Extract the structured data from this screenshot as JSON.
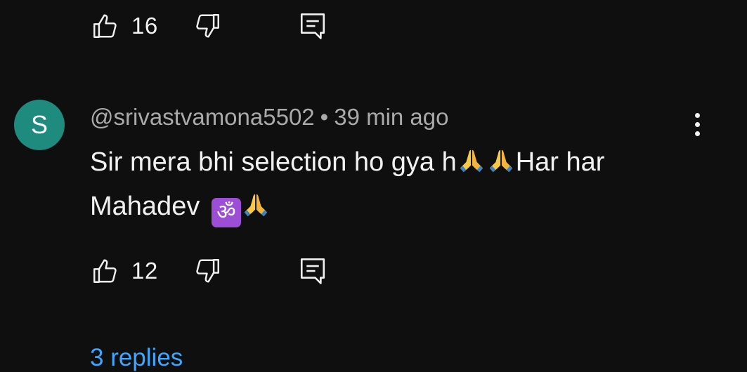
{
  "prev_comment": {
    "like_count": "16"
  },
  "comment": {
    "avatar_letter": "S",
    "author": "@srivastvamona5502",
    "separator": "•",
    "time": "39 min ago",
    "text_part1": "Sir mera bhi selection ho gya h",
    "text_part2": "Har har",
    "text_part3": "Mahadev ",
    "like_count": "12",
    "replies_label": "3 replies"
  },
  "colors": {
    "background": "#0f0f0f",
    "avatar": "#1f8a7e",
    "link": "#3ea6ff",
    "meta_text": "#aaaaaa"
  },
  "icons": {
    "like": "thumbs-up-icon",
    "dislike": "thumbs-down-icon",
    "reply": "comment-reply-icon",
    "menu": "more-vertical-icon",
    "emoji_hands": "folded-hands-emoji",
    "emoji_om": "om-emoji"
  }
}
